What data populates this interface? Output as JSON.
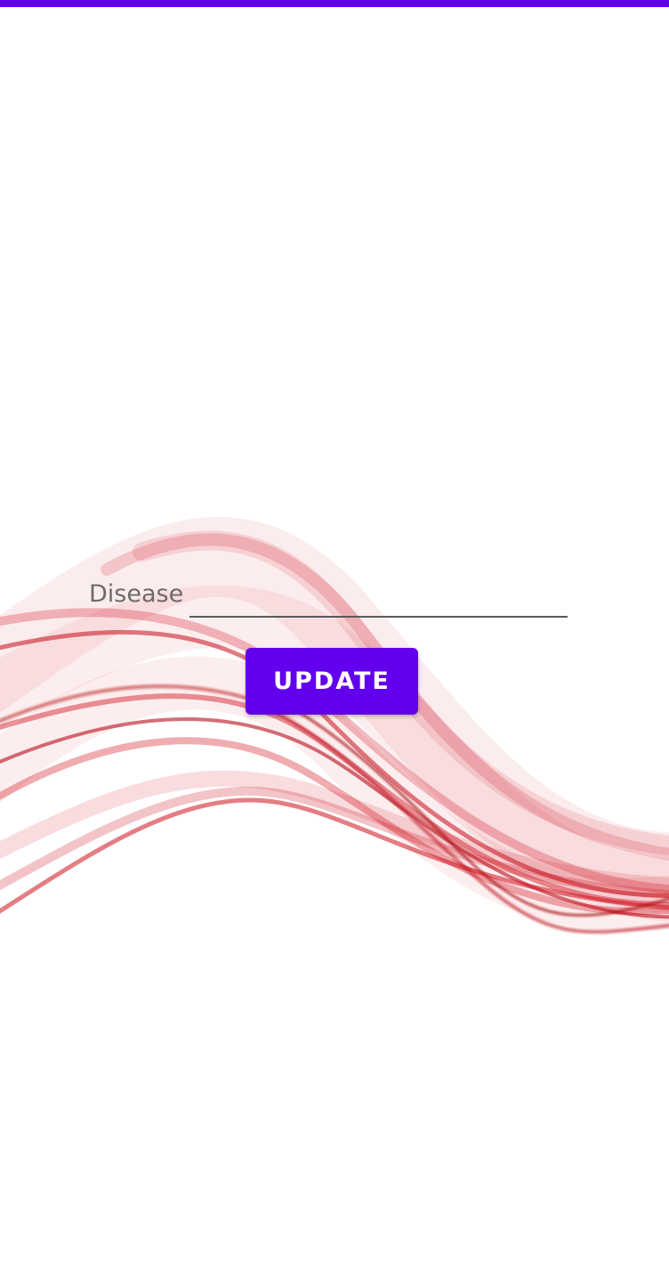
{
  "form": {
    "disease_label": "Disease",
    "disease_value": "",
    "update_label": "UPDATE"
  },
  "colors": {
    "primary": "#6200EE",
    "wave": "#d0121f",
    "label": "#6e6a6a"
  }
}
